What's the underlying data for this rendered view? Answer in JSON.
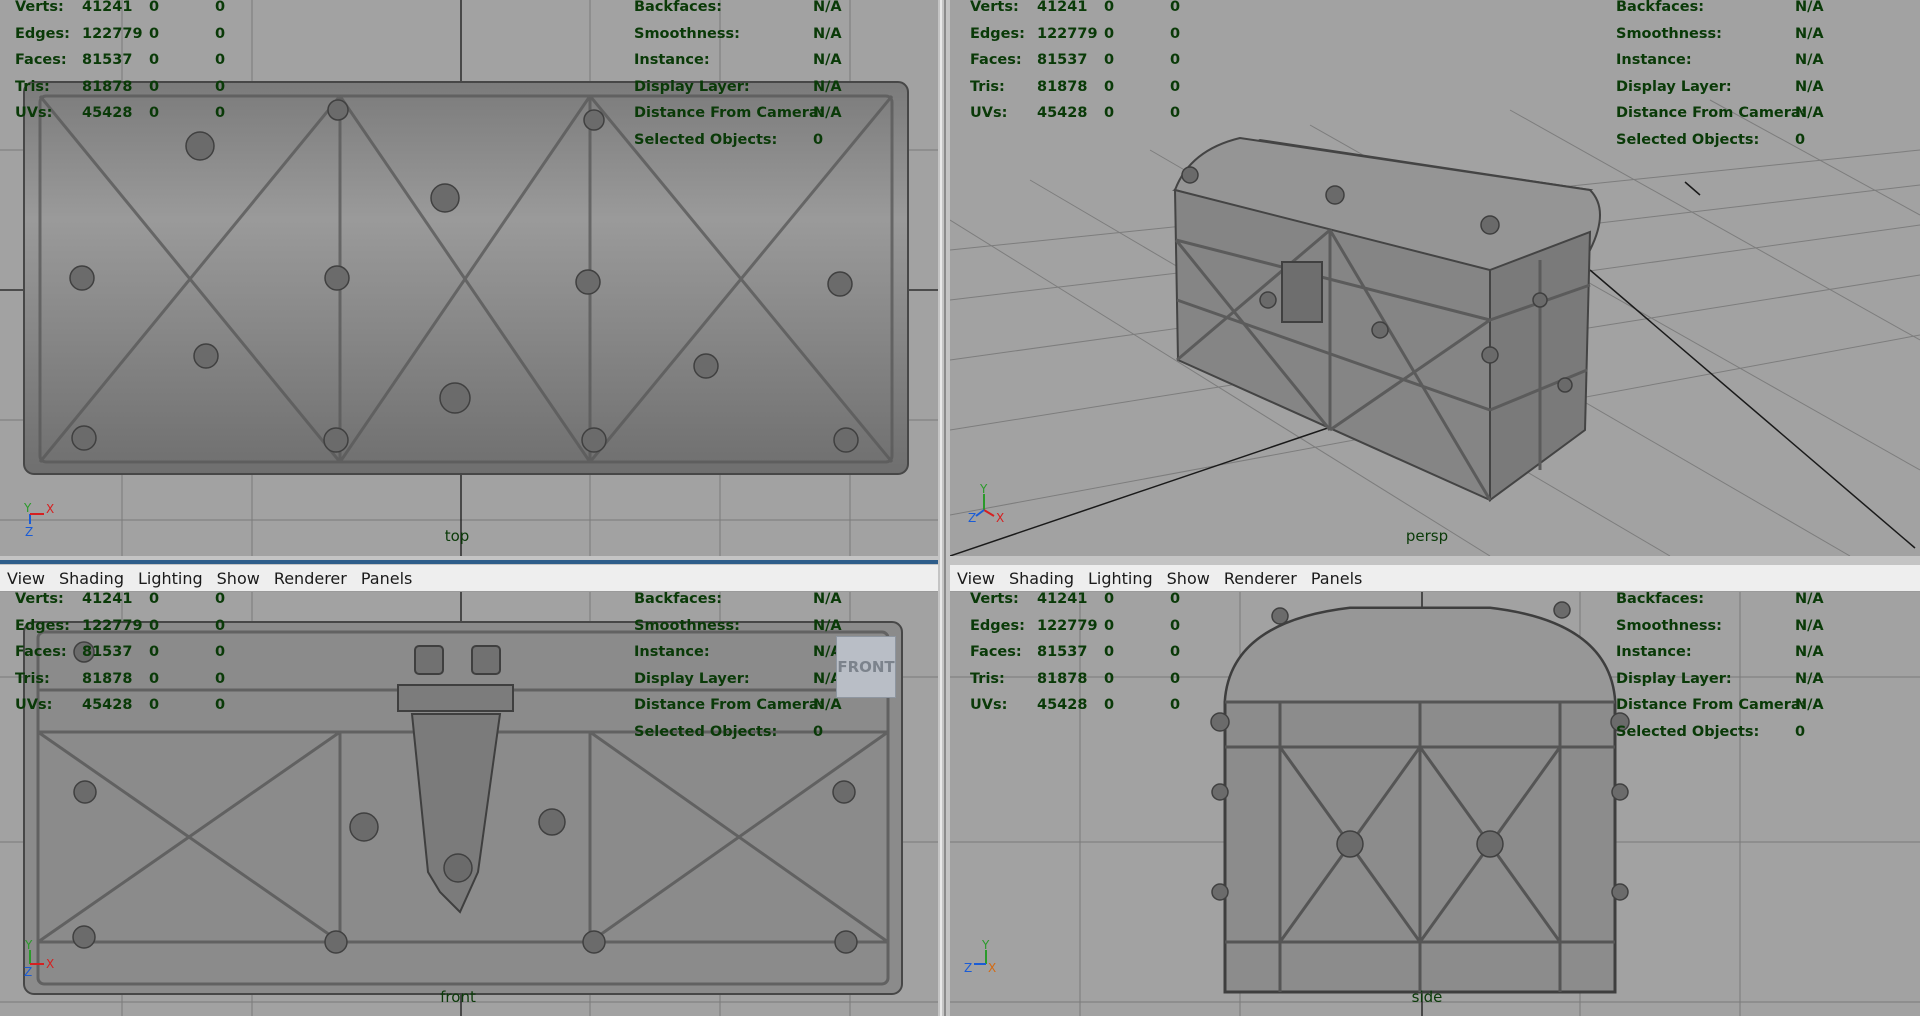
{
  "hud_left": {
    "rows": [
      {
        "label": "Verts:",
        "v1": "41241",
        "v2": "0",
        "v3": "0"
      },
      {
        "label": "Edges:",
        "v1": "122779",
        "v2": "0",
        "v3": "0"
      },
      {
        "label": "Faces:",
        "v1": "81537",
        "v2": "0",
        "v3": "0"
      },
      {
        "label": "Tris:",
        "v1": "81878",
        "v2": "0",
        "v3": "0"
      },
      {
        "label": "UVs:",
        "v1": "45428",
        "v2": "0",
        "v3": "0"
      }
    ]
  },
  "hud_right": {
    "rows": [
      {
        "label": "Backfaces:",
        "value": "N/A"
      },
      {
        "label": "Smoothness:",
        "value": "N/A"
      },
      {
        "label": "Instance:",
        "value": "N/A"
      },
      {
        "label": "Display Layer:",
        "value": "N/A"
      },
      {
        "label": "Distance From Camera:",
        "value": "N/A"
      },
      {
        "label": "Selected Objects:",
        "value": "0"
      }
    ]
  },
  "menu": {
    "view": "View",
    "shading": "Shading",
    "lighting": "Lighting",
    "show": "Show",
    "renderer": "Renderer",
    "panels": "Panels"
  },
  "viewports": {
    "top": {
      "label": "top",
      "axis_a": "Y",
      "axis_b": "X",
      "axis_c": "Z"
    },
    "persp": {
      "label": "persp",
      "axis_a": "Y",
      "axis_b": "X",
      "axis_c": "Z"
    },
    "front": {
      "label": "front",
      "axis_a": "Y",
      "axis_b": "X",
      "axis_c": "Z",
      "view_cube": "FRONT"
    },
    "side": {
      "label": "side",
      "axis_a": "Y",
      "axis_b": "X",
      "axis_c": "Z"
    }
  },
  "colors": {
    "hud_text": "#0a3a08",
    "viewport_bg": "#a2a2a2",
    "grid": "#7a7a7a",
    "axis_line": "#1a1a1a",
    "model": "#8a8a8a",
    "active_border": "#2e5d8a"
  },
  "icons": {
    "axis_indicator": "axis-gizmo-icon",
    "view_cube": "view-cube-icon"
  }
}
